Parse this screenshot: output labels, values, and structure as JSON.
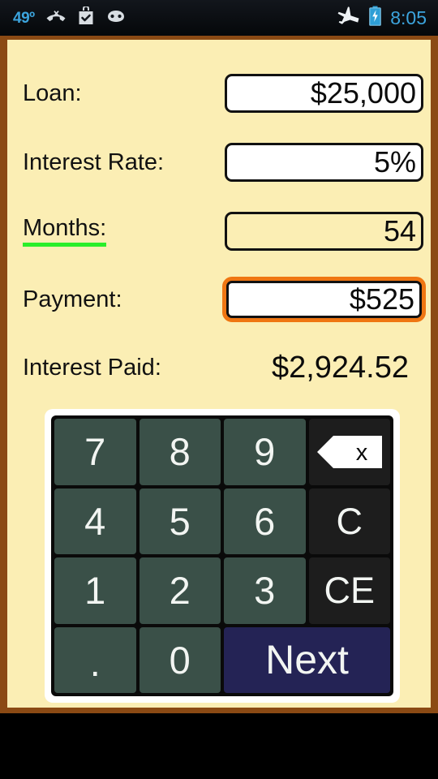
{
  "status_bar": {
    "temperature": "49º",
    "clock": "8:05",
    "left_icons": [
      {
        "name": "temperature-label"
      },
      {
        "name": "missed-call-icon"
      },
      {
        "name": "play-store-bag-check-icon"
      },
      {
        "name": "android-head-icon"
      }
    ],
    "right_icons": [
      {
        "name": "airplane-mode-icon"
      },
      {
        "name": "battery-charging-icon"
      }
    ],
    "colors": {
      "text": "#3ca4dd",
      "background": "#0b0e12"
    }
  },
  "app": {
    "colors": {
      "page_background": "#fbeeb4",
      "frame_border": "#8b4a14",
      "focus_ring": "#ef7612",
      "active_underline": "#2aee2a",
      "key_number": "#3a5048",
      "key_function": "#1d1d1d",
      "key_next": "#242355"
    },
    "fields": [
      {
        "label": "Loan:",
        "value": "$25,000",
        "state": "filled",
        "active": false
      },
      {
        "label": "Interest Rate:",
        "value": "5%",
        "state": "filled",
        "active": false
      },
      {
        "label": "Months:",
        "value": "54",
        "state": "empty",
        "active": true
      },
      {
        "label": "Payment:",
        "value": "$525",
        "state": "focused",
        "active": false
      }
    ],
    "result": {
      "label": "Interest Paid:",
      "value": "$2,924.52"
    },
    "keypad": {
      "keys": [
        {
          "label": "7",
          "name": "key-7",
          "kind": "num"
        },
        {
          "label": "8",
          "name": "key-8",
          "kind": "num"
        },
        {
          "label": "9",
          "name": "key-9",
          "kind": "num"
        },
        {
          "label": "x",
          "name": "backspace-key",
          "kind": "backspace"
        },
        {
          "label": "4",
          "name": "key-4",
          "kind": "num"
        },
        {
          "label": "5",
          "name": "key-5",
          "kind": "num"
        },
        {
          "label": "6",
          "name": "key-6",
          "kind": "num"
        },
        {
          "label": "C",
          "name": "clear-key",
          "kind": "fn"
        },
        {
          "label": "1",
          "name": "key-1",
          "kind": "num"
        },
        {
          "label": "2",
          "name": "key-2",
          "kind": "num"
        },
        {
          "label": "3",
          "name": "key-3",
          "kind": "num"
        },
        {
          "label": "CE",
          "name": "clear-entry-key",
          "kind": "fn"
        },
        {
          "label": ".",
          "name": "decimal-key",
          "kind": "dot"
        },
        {
          "label": "0",
          "name": "key-0",
          "kind": "num"
        },
        {
          "label": "Next",
          "name": "next-key",
          "kind": "next"
        }
      ]
    }
  }
}
